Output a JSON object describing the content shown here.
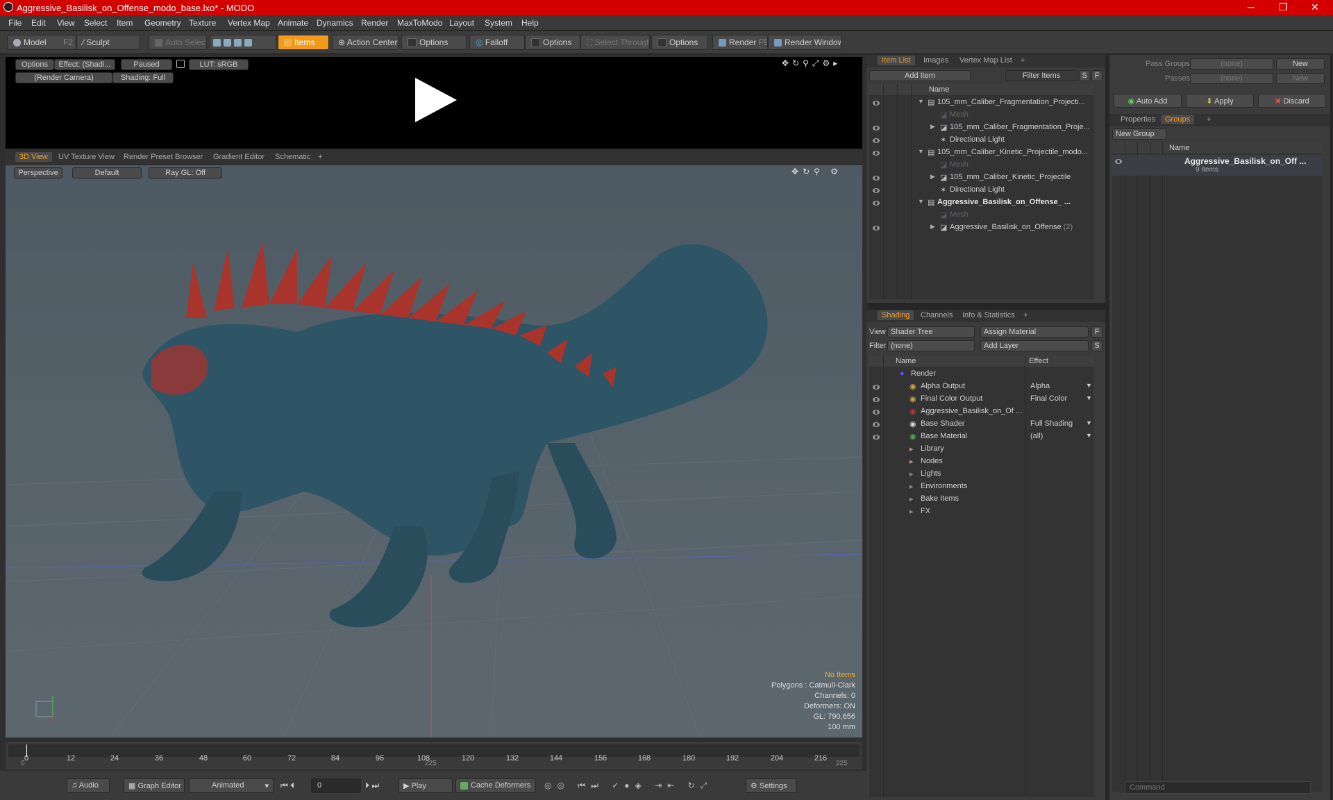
{
  "window": {
    "title": "Aggressive_Basilisk_on_Offense_modo_base.lxo* - MODO",
    "min": "─",
    "max": "❐",
    "close": "✕"
  },
  "menu": [
    "File",
    "Edit",
    "View",
    "Select",
    "Item",
    "Geometry",
    "Texture",
    "Vertex Map",
    "Animate",
    "Dynamics",
    "Render",
    "MaxToModo",
    "Layout",
    "System",
    "Help"
  ],
  "toolbar": {
    "model": "Model",
    "model_key": "F2",
    "sculpt": "Sculpt",
    "auto_select": "Auto Select",
    "items": "Items",
    "action_center": "Action Center",
    "options1": "Options",
    "falloff": "Falloff",
    "options2": "Options",
    "select_through": "Select Through",
    "options3": "Options",
    "render": "Render",
    "render_key": "F9",
    "render_window": "Render Window"
  },
  "preview": {
    "options": "Options",
    "effect": "Effect: (Shadi...",
    "paused": "Paused",
    "lut": "LUT: sRGB",
    "camera": "(Render Camera)",
    "shading": "Shading: Full"
  },
  "viewport_tabs": [
    "3D View",
    "UV Texture View",
    "Render Preset Browser",
    "Gradient Editor",
    "Schematic"
  ],
  "viewport": {
    "perspective": "Perspective",
    "default": "Default",
    "raygl": "Ray GL: Off",
    "stats": [
      "No Items",
      "Polygons : Catmull-Clark",
      "Channels: 0",
      "Deformers: ON",
      "GL: 790,656",
      "100 mm"
    ]
  },
  "timeline": {
    "labels": [
      "0",
      "12",
      "24",
      "36",
      "48",
      "60",
      "72",
      "84",
      "96",
      "108",
      "120",
      "132",
      "144",
      "156",
      "168",
      "180",
      "192",
      "204",
      "216"
    ],
    "start": "0",
    "mid": "225",
    "end": "225"
  },
  "bottom": {
    "audio": "Audio",
    "graph_editor": "Graph Editor",
    "animated": "Animated",
    "frame": "0",
    "play": "Play",
    "cache": "Cache Deformers",
    "settings": "Settings"
  },
  "itemlist": {
    "tabs": [
      "Item List",
      "Images",
      "Vertex Map List"
    ],
    "add_item": "Add Item",
    "filter_items": "Filter Items",
    "s": "S",
    "f": "F",
    "name_col": "Name",
    "rows": [
      {
        "label": "105_mm_Caliber_Fragmentation_Projecti...",
        "indent": 0,
        "type": "scene",
        "bold": false
      },
      {
        "label": "Mesh",
        "indent": 1,
        "type": "mesh",
        "bold": false
      },
      {
        "label": "105_mm_Caliber_Fragmentation_Proje...",
        "indent": 1,
        "type": "group",
        "bold": false
      },
      {
        "label": "Directional Light",
        "indent": 1,
        "type": "light",
        "bold": false
      },
      {
        "label": "105_mm_Caliber_Kinetic_Projectile_modo...",
        "indent": 0,
        "type": "scene",
        "bold": false
      },
      {
        "label": "Mesh",
        "indent": 1,
        "type": "mesh",
        "bold": false
      },
      {
        "label": "105_mm_Caliber_Kinetic_Projectile",
        "indent": 1,
        "type": "group",
        "bold": false
      },
      {
        "label": "Directional Light",
        "indent": 1,
        "type": "light",
        "bold": false
      },
      {
        "label": "Aggressive_Basilisk_on_Offense_ ...",
        "indent": 0,
        "type": "scene",
        "bold": true
      },
      {
        "label": "Mesh",
        "indent": 1,
        "type": "mesh",
        "bold": false
      },
      {
        "label": "Aggressive_Basilisk_on_Offense",
        "indent": 1,
        "type": "group",
        "bold": false,
        "suffix": "(2)"
      }
    ]
  },
  "shading": {
    "tabs": [
      "Shading",
      "Channels",
      "Info & Statistics"
    ],
    "view_label": "View",
    "view_value": "Shader Tree",
    "assign": "Assign Material",
    "f": "F",
    "filter_label": "Filter",
    "filter_value": "(none)",
    "add_layer": "Add Layer",
    "s": "S",
    "name_col": "Name",
    "effect_col": "Effect",
    "rows": [
      {
        "label": "Render",
        "effect": "",
        "indent": 0
      },
      {
        "label": "Alpha Output",
        "effect": "Alpha",
        "indent": 1
      },
      {
        "label": "Final Color Output",
        "effect": "Final Color",
        "indent": 1
      },
      {
        "label": "Aggressive_Basilisk_on_Of ...",
        "effect": "",
        "indent": 1
      },
      {
        "label": "Base Shader",
        "effect": "Full Shading",
        "indent": 1
      },
      {
        "label": "Base Material",
        "effect": "(all)",
        "indent": 1
      },
      {
        "label": "Library",
        "effect": "",
        "indent": 0
      },
      {
        "label": "Nodes",
        "effect": "",
        "indent": 0
      },
      {
        "label": "Lights",
        "effect": "",
        "indent": 0
      },
      {
        "label": "Environments",
        "effect": "",
        "indent": 0
      },
      {
        "label": "Bake Items",
        "effect": "",
        "indent": 0
      },
      {
        "label": "FX",
        "effect": "",
        "indent": 0
      }
    ]
  },
  "groups": {
    "pass_groups": "Pass Groups",
    "pass_groups_value": "(none)",
    "new": "New",
    "passes": "Passes",
    "passes_value": "(none)",
    "new2": "New",
    "auto_add": "Auto Add",
    "apply": "Apply",
    "discard": "Discard",
    "tabs": [
      "Properties",
      "Groups"
    ],
    "new_group": "New Group",
    "name_col": "Name",
    "group_name": "Aggressive_Basilisk_on_Off ...",
    "group_count": "9 Items"
  },
  "command": {
    "placeholder": "Command"
  }
}
